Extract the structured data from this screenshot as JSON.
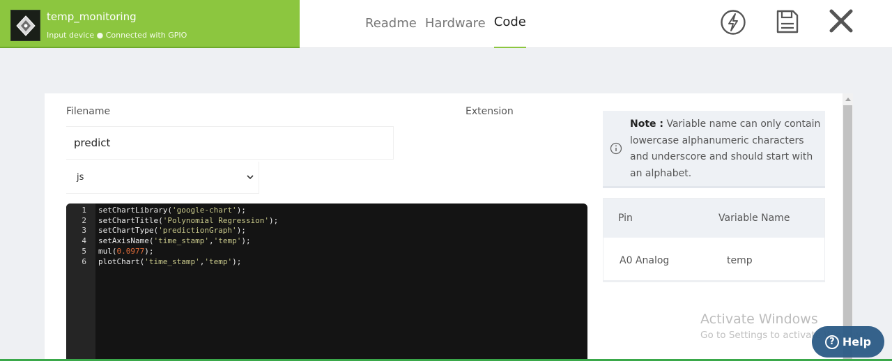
{
  "device": {
    "name": "temp_monitoring",
    "status": "Input device ● Connected with GPIO"
  },
  "tabs": [
    {
      "label": "Readme",
      "active": false
    },
    {
      "label": "Hardware",
      "active": false
    },
    {
      "label": "Code",
      "active": true
    }
  ],
  "header_icons": [
    "flash-icon",
    "save-icon",
    "close-icon"
  ],
  "form": {
    "filename_label": "Filename",
    "extension_label": "Extension",
    "filename_value": "predict",
    "extension_value": "js"
  },
  "editor": {
    "lines": [
      {
        "num": "1",
        "parts": [
          {
            "t": "setChartLibrary(",
            "c": "p"
          },
          {
            "t": "'google-chart'",
            "c": "s"
          },
          {
            "t": ");",
            "c": "p"
          }
        ]
      },
      {
        "num": "2",
        "parts": [
          {
            "t": "setChartTitle(",
            "c": "p"
          },
          {
            "t": "'Polynomial Regression'",
            "c": "s"
          },
          {
            "t": ");",
            "c": "p"
          }
        ]
      },
      {
        "num": "3",
        "parts": [
          {
            "t": "setChartType(",
            "c": "p"
          },
          {
            "t": "'predictionGraph'",
            "c": "s"
          },
          {
            "t": ");",
            "c": "p"
          }
        ]
      },
      {
        "num": "4",
        "parts": [
          {
            "t": "setAxisName(",
            "c": "p"
          },
          {
            "t": "'time_stamp'",
            "c": "s"
          },
          {
            "t": ",",
            "c": "p"
          },
          {
            "t": "'temp'",
            "c": "s"
          },
          {
            "t": ");",
            "c": "p"
          }
        ]
      },
      {
        "num": "5",
        "parts": [
          {
            "t": "mul(",
            "c": "p"
          },
          {
            "t": "0.0977",
            "c": "n"
          },
          {
            "t": ");",
            "c": "p"
          }
        ]
      },
      {
        "num": "6",
        "parts": [
          {
            "t": "plotChart(",
            "c": "p"
          },
          {
            "t": "'time_stamp'",
            "c": "s"
          },
          {
            "t": ",",
            "c": "p"
          },
          {
            "t": "'temp'",
            "c": "s"
          },
          {
            "t": ");",
            "c": "p"
          }
        ]
      }
    ]
  },
  "note": {
    "label": "Note :",
    "text": " Variable name can only contain lowercase alphanumeric characters and underscore and should start with an alphabet."
  },
  "pins": {
    "headers": {
      "pin": "Pin",
      "variable": "Variable Name"
    },
    "rows": [
      {
        "pin": "A0 Analog",
        "variable": "temp"
      }
    ]
  },
  "watermark": {
    "title": "Activate Windows",
    "subtitle": "Go to Settings to activate Windows."
  },
  "help": {
    "label": "Help"
  },
  "colors": {
    "accent": "#8cc63f",
    "help_bg": "#2c5b86",
    "editor_bg": "#141414",
    "string": "#c8c88a",
    "number": "#e06c3a"
  }
}
